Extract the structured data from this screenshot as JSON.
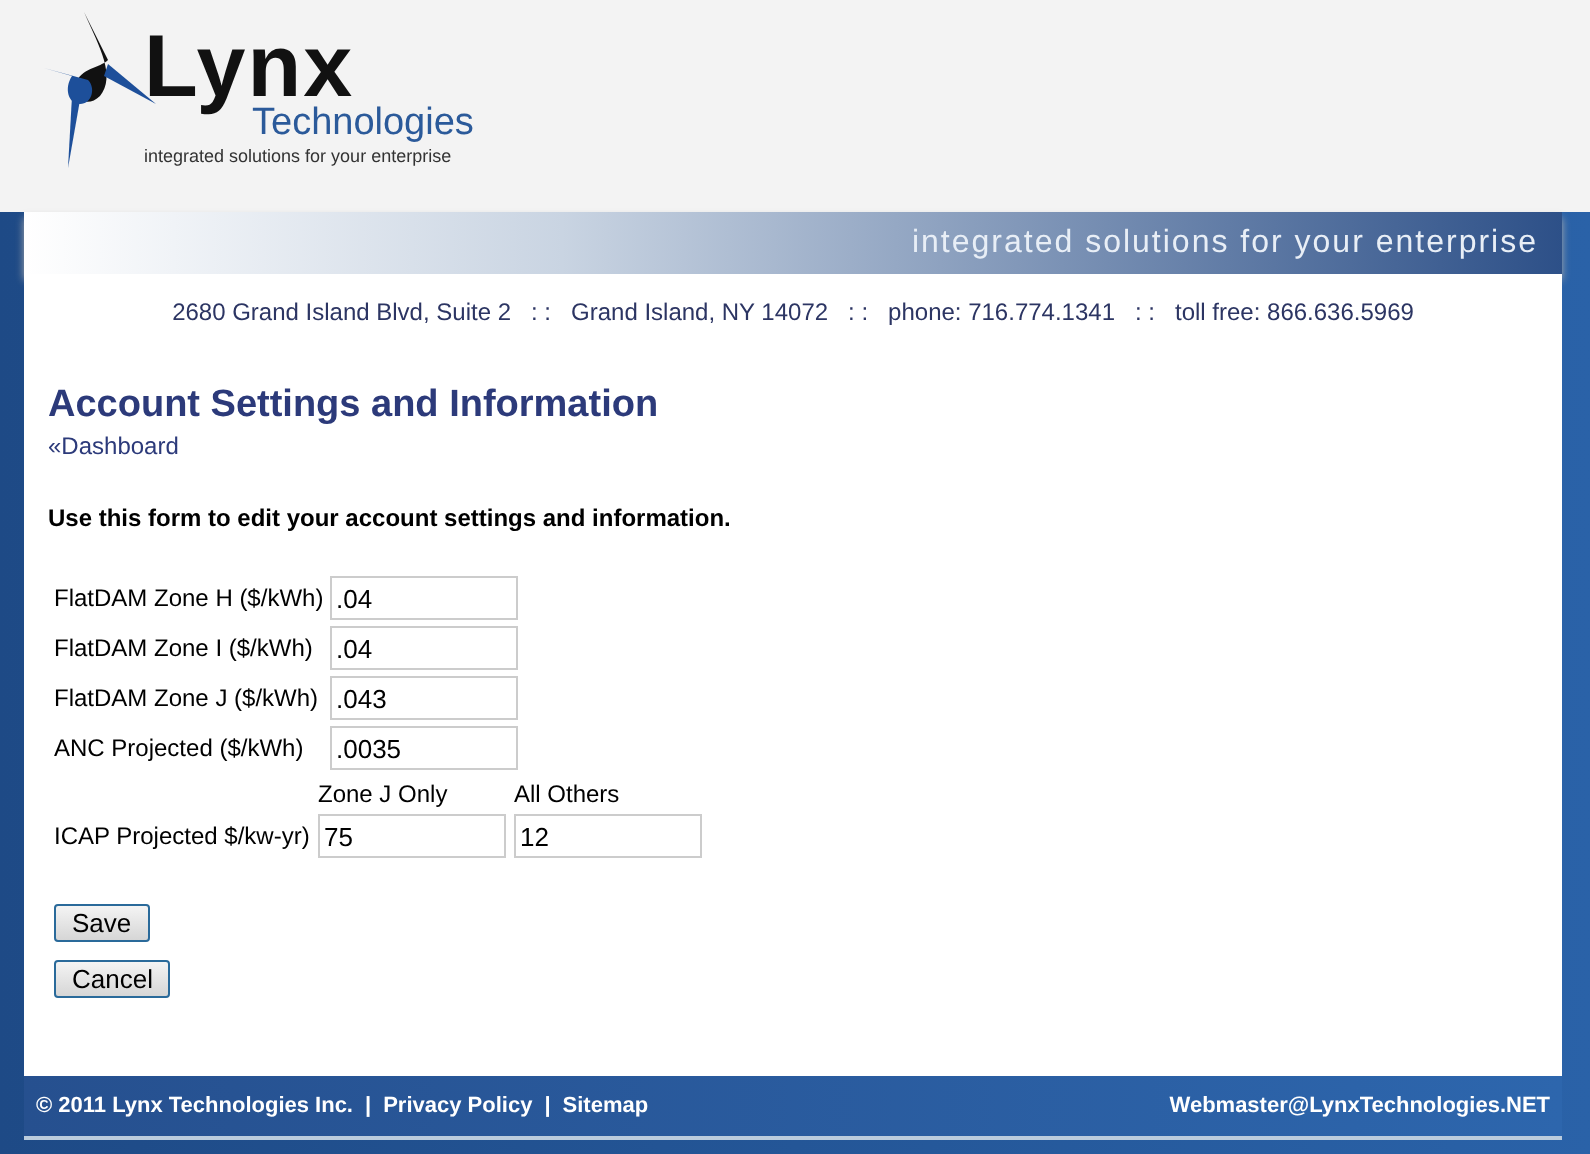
{
  "logo": {
    "name": "Lynx",
    "sub": "Technologies",
    "tagline": "integrated solutions for your enterprise"
  },
  "banner": {
    "slogan": "integrated solutions for your enterprise"
  },
  "contact": "2680 Grand Island Blvd, Suite 2   : :   Grand Island, NY 14072   : :   phone: 716.774.1341   : :   toll free: 866.636.5969",
  "page": {
    "title": "Account Settings and Information",
    "back_link": "«Dashboard",
    "intro": "Use this form to edit your account settings and information."
  },
  "fields": [
    {
      "label": "FlatDAM Zone H ($/kWh)",
      "value": ".04"
    },
    {
      "label": "FlatDAM Zone I ($/kWh)",
      "value": ".04"
    },
    {
      "label": "FlatDAM Zone J ($/kWh)",
      "value": ".043"
    },
    {
      "label": "ANC Projected ($/kWh)",
      "value": ".0035"
    }
  ],
  "icap": {
    "label": "ICAP Projected $/kw-yr)",
    "columns": [
      {
        "heading": "Zone J Only",
        "value": "75"
      },
      {
        "heading": "All Others",
        "value": "12"
      }
    ]
  },
  "buttons": [
    "Save",
    "Cancel"
  ],
  "footer": {
    "copyright": "© 2011 Lynx Technologies Inc.",
    "separators": [
      "|",
      "|"
    ],
    "links": [
      "Privacy Policy",
      "Sitemap"
    ],
    "email": "Webmaster@LynxTechnologies.NET"
  }
}
